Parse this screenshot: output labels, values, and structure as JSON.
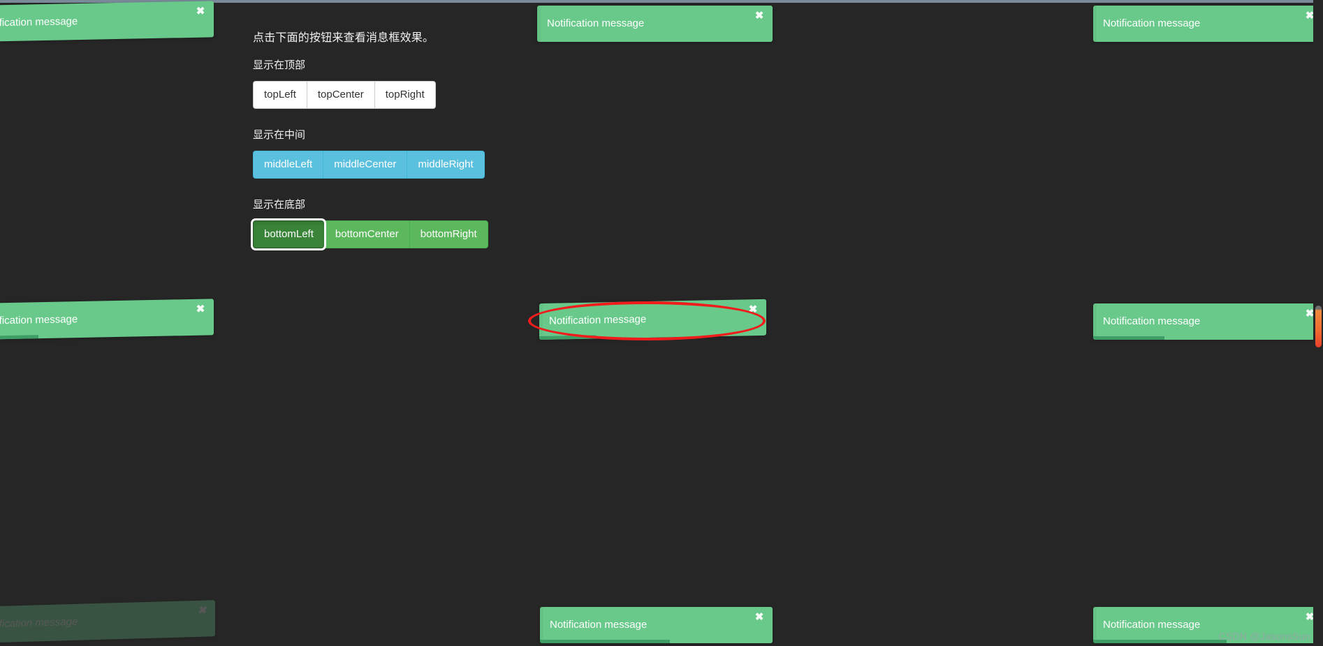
{
  "page": {
    "background_color": "#262626",
    "top_strip_color": "#7a8a99",
    "watermark": "CSDN @JasonsSun"
  },
  "panel": {
    "intro": "点击下面的按钮来查看消息框效果。",
    "groups": [
      {
        "label": "显示在顶部",
        "style": "default",
        "buttons": [
          {
            "label": "topLeft",
            "focused": false
          },
          {
            "label": "topCenter",
            "focused": false
          },
          {
            "label": "topRight",
            "focused": false
          }
        ]
      },
      {
        "label": "显示在中间",
        "style": "info",
        "buttons": [
          {
            "label": "middleLeft",
            "focused": false
          },
          {
            "label": "middleCenter",
            "focused": false
          },
          {
            "label": "middleRight",
            "focused": false
          }
        ]
      },
      {
        "label": "显示在底部",
        "style": "success",
        "buttons": [
          {
            "label": "bottomLeft",
            "focused": true
          },
          {
            "label": "bottomCenter",
            "focused": false
          },
          {
            "label": "bottomRight",
            "focused": false
          }
        ]
      }
    ]
  },
  "colors": {
    "toast_green": "#68c98a",
    "toast_progress_green": "#3f9e66",
    "button_default_bg": "#ffffff",
    "button_info_bg": "#5bc0de",
    "button_success_bg": "#5cb85c",
    "button_focus_bg": "#398439",
    "annotation_red": "#f01c1c",
    "scrollbar_orange": "#f06a30"
  },
  "toasts": [
    {
      "id": "top-left",
      "message": "Notification message",
      "close_icon": "✖",
      "position": "topLeft",
      "progress_percent": 0,
      "state": "visible"
    },
    {
      "id": "top-center",
      "message": "Notification message",
      "close_icon": "✖",
      "position": "topCenter",
      "progress_percent": 0,
      "state": "visible"
    },
    {
      "id": "top-right",
      "message": "Notification message",
      "close_icon": "✖",
      "position": "topRight",
      "progress_percent": 0,
      "state": "visible"
    },
    {
      "id": "middle-left",
      "message": "Notification message",
      "close_icon": "✖",
      "position": "middleLeft",
      "progress_percent": 28,
      "state": "visible"
    },
    {
      "id": "middle-center",
      "message": "Notification message",
      "close_icon": "✖",
      "position": "middleCenter",
      "progress_percent": 25,
      "state": "visible",
      "annotated": true
    },
    {
      "id": "middle-right",
      "message": "Notification message",
      "close_icon": "✖",
      "position": "middleRight",
      "progress_percent": 31,
      "state": "visible"
    },
    {
      "id": "bottom-left",
      "message": "Notification message",
      "close_icon": "✖",
      "position": "bottomLeft",
      "progress_percent": 0,
      "state": "fading"
    },
    {
      "id": "bottom-center",
      "message": "Notification message",
      "close_icon": "✖",
      "position": "bottomCenter",
      "progress_percent": 56,
      "state": "visible"
    },
    {
      "id": "bottom-right",
      "message": "Notification message",
      "close_icon": "✖",
      "position": "bottomRight",
      "progress_percent": 58,
      "state": "visible"
    }
  ]
}
